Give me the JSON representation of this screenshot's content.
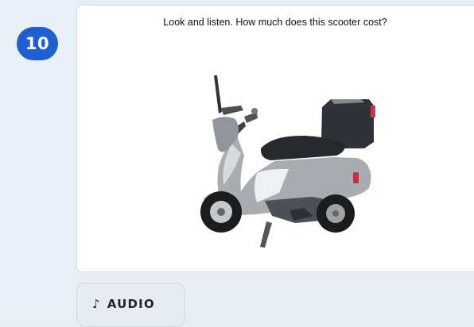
{
  "question": {
    "number": "10",
    "prompt": "Look and listen. How much does this scooter cost?"
  },
  "media": {
    "image_subject": "scooter"
  },
  "audio": {
    "label": "AUDIO",
    "icon": "music-note-icon"
  },
  "colors": {
    "badge": "#1f5fd1",
    "rail": "#eaf0f7",
    "card": "#ffffff",
    "button_bg": "#e7ecf3"
  }
}
